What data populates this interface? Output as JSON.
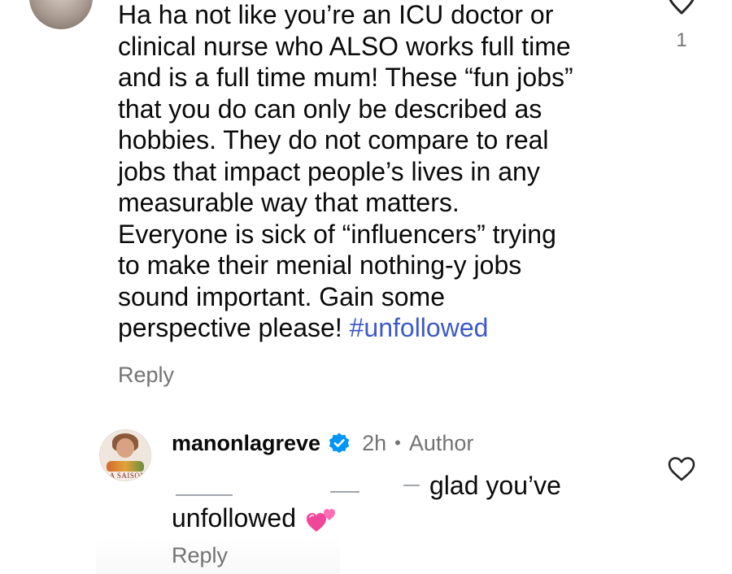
{
  "colors": {
    "text": "#0a0a0a",
    "secondary": "#737373",
    "hashtag": "#3d5ac8",
    "verified": "#0095f6"
  },
  "top_comment": {
    "avatar_icon": "user-avatar",
    "like_icon": "heart-outline-icon",
    "like_count": "1",
    "text_lines": [
      "Ha ha not like you’re an ICU doctor or",
      "clinical nurse who ALSO works full time",
      "and is a full time mum! These “fun jobs”",
      "that you do can only be described as",
      "hobbies. They do not compare to real",
      "jobs that impact people’s lives in any",
      "measurable way that matters.",
      "Everyone is sick of “influencers” trying",
      "to make their menial nothing-y jobs",
      "sound important. Gain some",
      "perspective please! "
    ],
    "hashtag": "#unfollowed",
    "reply_label": "Reply"
  },
  "author_reply": {
    "avatar_icon": "user-avatar",
    "avatar_logo_text": "LA SAISON",
    "username": "manonlagreve",
    "verified_icon": "verified-badge-icon",
    "timestamp": "2h",
    "separator": "•",
    "author_label": "Author",
    "text_line1": "glad you’ve",
    "text_line2": "unfollowed",
    "emoji_icon": "two-hearts-emoji",
    "like_icon": "heart-outline-icon",
    "reply_label": "Reply"
  }
}
